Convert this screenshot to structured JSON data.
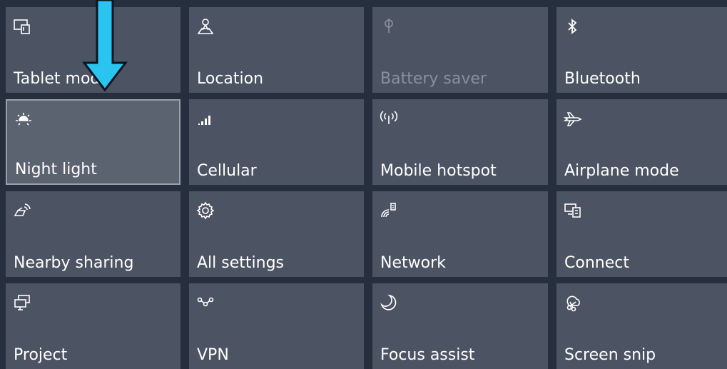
{
  "colors": {
    "background": "#262f3d",
    "tile": "#4c5363",
    "tile_active": "#5b6270",
    "text": "#ffffff",
    "text_disabled": "#8a909b",
    "arrow": "#29c5f0"
  },
  "tiles": [
    {
      "label": "Tablet mode",
      "icon": "tablet-mode-icon"
    },
    {
      "label": "Location",
      "icon": "location-icon"
    },
    {
      "label": "Battery saver",
      "icon": "battery-saver-icon",
      "state": "disabled"
    },
    {
      "label": "Bluetooth",
      "icon": "bluetooth-icon"
    },
    {
      "label": "Night light",
      "icon": "night-light-icon",
      "state": "active"
    },
    {
      "label": "Cellular",
      "icon": "cellular-icon"
    },
    {
      "label": "Mobile hotspot",
      "icon": "mobile-hotspot-icon"
    },
    {
      "label": "Airplane mode",
      "icon": "airplane-mode-icon"
    },
    {
      "label": "Nearby sharing",
      "icon": "nearby-sharing-icon"
    },
    {
      "label": "All settings",
      "icon": "gear-icon"
    },
    {
      "label": "Network",
      "icon": "network-icon"
    },
    {
      "label": "Connect",
      "icon": "connect-icon"
    },
    {
      "label": "Project",
      "icon": "project-icon"
    },
    {
      "label": "VPN",
      "icon": "vpn-icon"
    },
    {
      "label": "Focus assist",
      "icon": "moon-icon"
    },
    {
      "label": "Screen snip",
      "icon": "screen-snip-icon"
    }
  ]
}
